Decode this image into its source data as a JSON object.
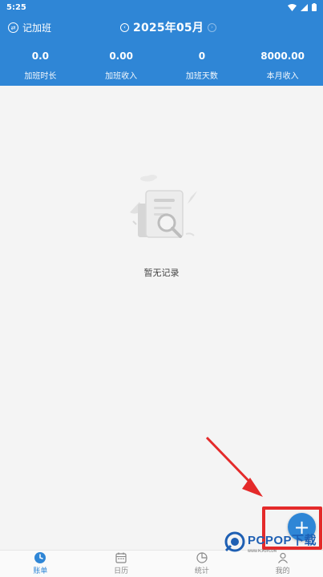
{
  "status_bar": {
    "time": "5:25"
  },
  "header": {
    "brand_label": "记加班",
    "month": "2025年05月"
  },
  "summary": [
    {
      "value": "0.0",
      "label": "加班时长"
    },
    {
      "value": "0.00",
      "label": "加班收入"
    },
    {
      "value": "0",
      "label": "加班天数"
    },
    {
      "value": "8000.00",
      "label": "本月收入"
    }
  ],
  "empty_state": {
    "text": "暂无记录"
  },
  "fab": {
    "icon": "plus-icon"
  },
  "bottom_nav": [
    {
      "label": "账单",
      "icon": "clock-icon",
      "active": true
    },
    {
      "label": "日历",
      "icon": "calendar-icon",
      "active": false
    },
    {
      "label": "统计",
      "icon": "pie-chart-icon",
      "active": false
    },
    {
      "label": "我的",
      "icon": "user-icon",
      "active": false
    }
  ],
  "watermark": {
    "text": "PCPOP下载",
    "sub": "WWW.PCPOP.COM"
  },
  "colors": {
    "primary": "#2f86d6",
    "annotation": "#e42a2a"
  }
}
